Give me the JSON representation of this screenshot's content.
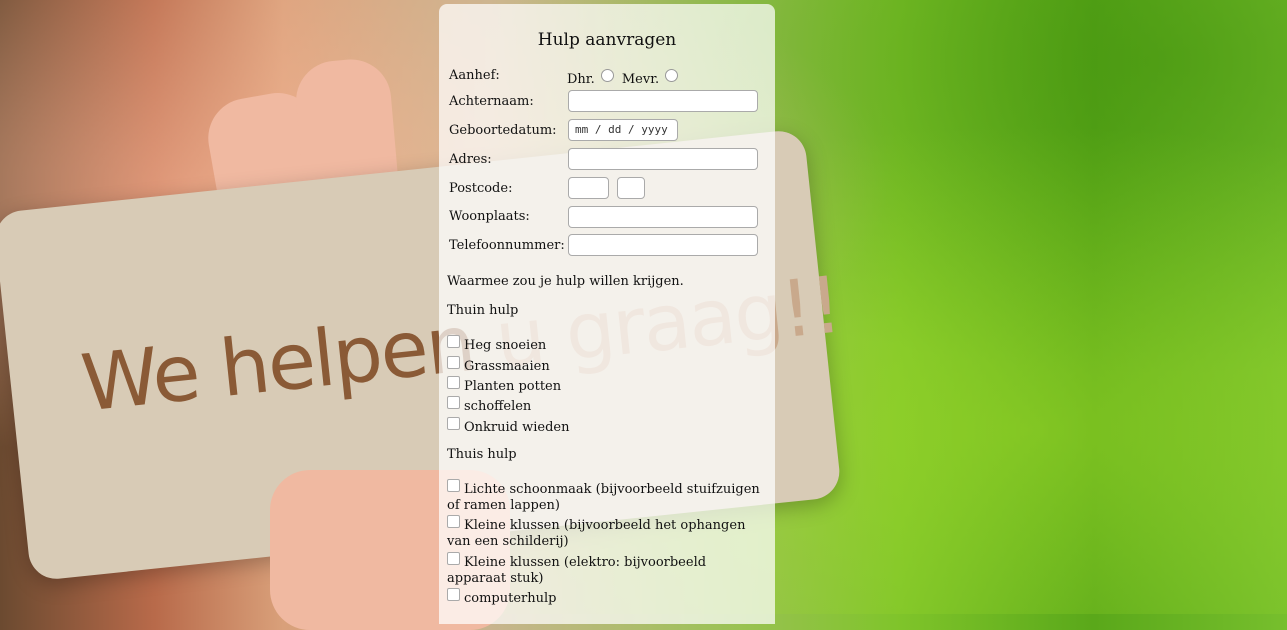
{
  "form": {
    "title": "Hulp aanvragen",
    "aanhef_label": "Aanhef:",
    "dhr_label": "Dhr.",
    "mevr_label": "Mevr.",
    "achternaam_label": "Achternaam:",
    "geboortedatum_label": "Geboortedatum:",
    "geboortedatum_placeholder": "mm / dd / yyyy",
    "adres_label": "Adres:",
    "postcode_label": "Postcode:",
    "woonplaats_label": "Woonplaats:",
    "telefoon_label": "Telefoonnummer:",
    "question": "Waarmee zou je hulp willen krijgen.",
    "thuin": {
      "heading": "Thuin hulp",
      "items": [
        "Heg snoeien",
        "Grassmaaien",
        "Planten potten",
        "schoffelen",
        "Onkruid wieden"
      ]
    },
    "thuis": {
      "heading": "Thuis hulp",
      "items": [
        "Lichte schoonmaak (bijvoorbeeld stuifzuigen of ramen lappen)",
        "Kleine klussen (bijvoorbeeld het ophangen van een schilderij)",
        "Kleine klussen (elektro: bijvoorbeeld apparaat stuk)",
        "computerhulp"
      ]
    }
  },
  "background": {
    "card_text_main": "We helpen",
    "card_text_faded": "u graag!!"
  }
}
